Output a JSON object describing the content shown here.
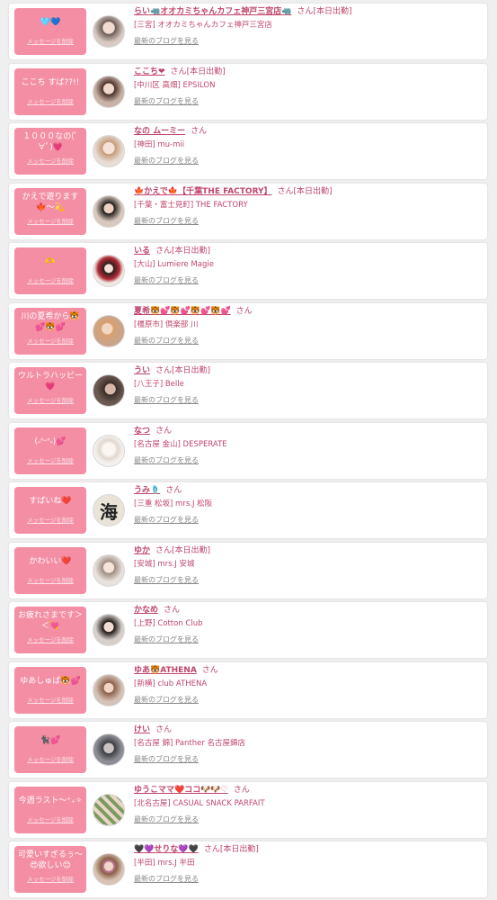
{
  "colors": {
    "page_bg": "#efefef",
    "card_bg": "#ffffff",
    "message_bg": "#f48ea4",
    "accent_text": "#c0456b",
    "link_gray": "#888888"
  },
  "labels": {
    "delete_message": "メッセージを削除",
    "latest_blog": "最新のブログを見る",
    "san": "さん"
  },
  "favorites": [
    {
      "message": "🩵💙",
      "name": "らい🦏オオカミちゃんカフェ神戸三宮店🦏",
      "status": "[本日出勤]",
      "area": "[三宮]",
      "shop": "オオカミちゃんカフェ神戸三宮店",
      "avatar_icon": "portrait-photo"
    },
    {
      "message": "ここち すば??!!",
      "name": "ここち❤",
      "status": "[本日出勤]",
      "area": "[中川区 高畑]",
      "shop": "EPSILON",
      "avatar_icon": "portrait-photo"
    },
    {
      "message": "１０００なの(ﾟ∀ﾟ)💗",
      "name": "なの ムーミー",
      "status": "",
      "area": "[神田]",
      "shop": "mu-mii",
      "avatar_icon": "portrait-photo"
    },
    {
      "message": "かえで遊ります🍁〜💫",
      "name": "🍁かえで🍁【千葉THE FACTORY】",
      "status": "[本日出勤]",
      "area": "[千葉・富士見町]",
      "shop": "THE FACTORY",
      "avatar_icon": "portrait-photo"
    },
    {
      "message": "🫶",
      "name": "いる",
      "status": "[本日出勤]",
      "area": "[大山]",
      "shop": "Lumiere Magie",
      "avatar_icon": "portrait-photo"
    },
    {
      "message": "川の夏希から🐯💕🐯💕",
      "name": "夏希🐯💕🐯💕🐯💕🐯💕",
      "status": "",
      "area": "[橿原市]",
      "shop": "倶楽部 川",
      "avatar_icon": "portrait-photo"
    },
    {
      "message": "ウルトラハッピー💗",
      "name": "うい",
      "status": "[本日出勤]",
      "area": "[八王子]",
      "shop": "Belle",
      "avatar_icon": "portrait-photo"
    },
    {
      "message": "(˶ᐢᵕᐢ˶)💕",
      "name": "なつ",
      "status": "",
      "area": "[名古屋 金山]",
      "shop": "DESPERATE",
      "avatar_icon": "portrait-photo"
    },
    {
      "message": "すばいね❤️",
      "name": "うみ🩴",
      "status": "",
      "area": "[三重 松坂]",
      "shop": "mrs.J 松阪",
      "avatar_icon": "kanji-umi",
      "avatar_char": "海"
    },
    {
      "message": "かわいい❤️",
      "name": "ゆか",
      "status": "[本日出勤]",
      "area": "[安城]",
      "shop": "mrs.J 安城",
      "avatar_icon": "portrait-photo"
    },
    {
      "message": "お疲れさまです＞＜💘",
      "name": "かなめ",
      "status": "",
      "area": "[上野]",
      "shop": "Cotton Club",
      "avatar_icon": "portrait-photo"
    },
    {
      "message": "ゆあしゅば🐯💕",
      "name": "ゆあ🐯ATHENA",
      "status": "",
      "area": "[新横]",
      "shop": "club ATHENA",
      "avatar_icon": "portrait-photo"
    },
    {
      "message": "🐈‍⬛💕",
      "name": "けい",
      "status": "",
      "area": "[名古屋 錦]",
      "shop": "Panther 名古屋錦店",
      "avatar_icon": "portrait-photo"
    },
    {
      "message": "今週ラスト〜⁺₊✧",
      "name": "ゆうこママ❤️ココ🐶🐶♡",
      "status": "",
      "area": "[北名古屋]",
      "shop": "CASUAL SNACK PARFAIT",
      "avatar_icon": "portrait-photo"
    },
    {
      "message": "可愛いすぎるぅ〜😍欲しい😊",
      "name": "🖤💜せりな💜🖤",
      "status": "[本日出勤]",
      "area": "[半田]",
      "shop": "mrs.J 半田",
      "avatar_icon": "portrait-photo"
    }
  ]
}
